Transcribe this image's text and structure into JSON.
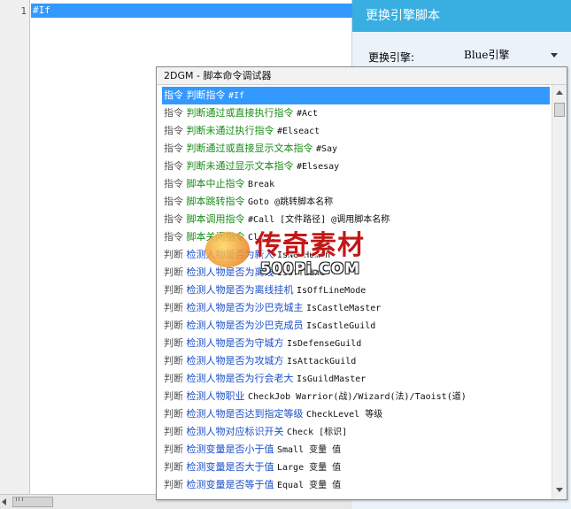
{
  "editor": {
    "lines": [
      {
        "number": "1",
        "text": "#If"
      }
    ]
  },
  "panel": {
    "title": "更换引擎脚本",
    "engine_label": "更换引擎:",
    "engine_value": "Blue引擎"
  },
  "debugger": {
    "title": "2DGM - 脚本命令调试器",
    "items": [
      {
        "category": "指令",
        "name": "判断指令",
        "syntax": "#If",
        "color": "green"
      },
      {
        "category": "指令",
        "name": "判断通过或直接执行指令",
        "syntax": "#Act",
        "color": "green"
      },
      {
        "category": "指令",
        "name": "判断未通过执行指令",
        "syntax": "#Elseact",
        "color": "green"
      },
      {
        "category": "指令",
        "name": "判断通过或直接显示文本指令",
        "syntax": "#Say",
        "color": "green"
      },
      {
        "category": "指令",
        "name": "判断未通过显示文本指令",
        "syntax": "#Elsesay",
        "color": "green"
      },
      {
        "category": "指令",
        "name": "脚本中止指令",
        "syntax": "Break",
        "color": "green"
      },
      {
        "category": "指令",
        "name": "脚本跳转指令",
        "syntax": "Goto @跳转脚本名称",
        "color": "green"
      },
      {
        "category": "指令",
        "name": "脚本调用指令",
        "syntax": "#Call [文件路径] @调用脚本名称",
        "color": "green"
      },
      {
        "category": "指令",
        "name": "脚本关闭指令",
        "syntax": "Close",
        "color": "green"
      },
      {
        "category": "判断",
        "name": "检测人物是否为新人",
        "syntax": "IsNewHuman",
        "color": "blue"
      },
      {
        "category": "判断",
        "name": "检测人物是否为离线",
        "syntax": "IsOffLine",
        "color": "blue"
      },
      {
        "category": "判断",
        "name": "检测人物是否为离线挂机",
        "syntax": "IsOffLineMode",
        "color": "blue"
      },
      {
        "category": "判断",
        "name": "检测人物是否为沙巴克城主",
        "syntax": "IsCastleMaster",
        "color": "blue"
      },
      {
        "category": "判断",
        "name": "检测人物是否为沙巴克成员",
        "syntax": "IsCastleGuild",
        "color": "blue"
      },
      {
        "category": "判断",
        "name": "检测人物是否为守城方",
        "syntax": "IsDefenseGuild",
        "color": "blue"
      },
      {
        "category": "判断",
        "name": "检测人物是否为攻城方",
        "syntax": "IsAttackGuild",
        "color": "blue"
      },
      {
        "category": "判断",
        "name": "检测人物是否为行会老大",
        "syntax": "IsGuildMaster",
        "color": "blue"
      },
      {
        "category": "判断",
        "name": "检测人物职业",
        "syntax": "CheckJob Warrior(战)/Wizard(法)/Taoist(道)",
        "color": "blue"
      },
      {
        "category": "判断",
        "name": "检测人物是否达到指定等级",
        "syntax": "CheckLevel 等级",
        "color": "blue"
      },
      {
        "category": "判断",
        "name": "检测人物对应标识开关",
        "syntax": "Check [标识]",
        "color": "blue"
      },
      {
        "category": "判断",
        "name": "检测变量是否小于值",
        "syntax": "Small 变量 值",
        "color": "blue"
      },
      {
        "category": "判断",
        "name": "检测变量是否大于值",
        "syntax": "Large 变量 值",
        "color": "blue"
      },
      {
        "category": "判断",
        "name": "检测变量是否等于值",
        "syntax": "Equal 变量 值",
        "color": "blue"
      }
    ]
  },
  "watermark": {
    "main": "传奇素材",
    "sub": "500Pi.COM"
  },
  "colors": {
    "accent": "#39aee0",
    "selection": "#3399ff",
    "instruction": "#188c18",
    "condition": "#1c4fc8"
  }
}
